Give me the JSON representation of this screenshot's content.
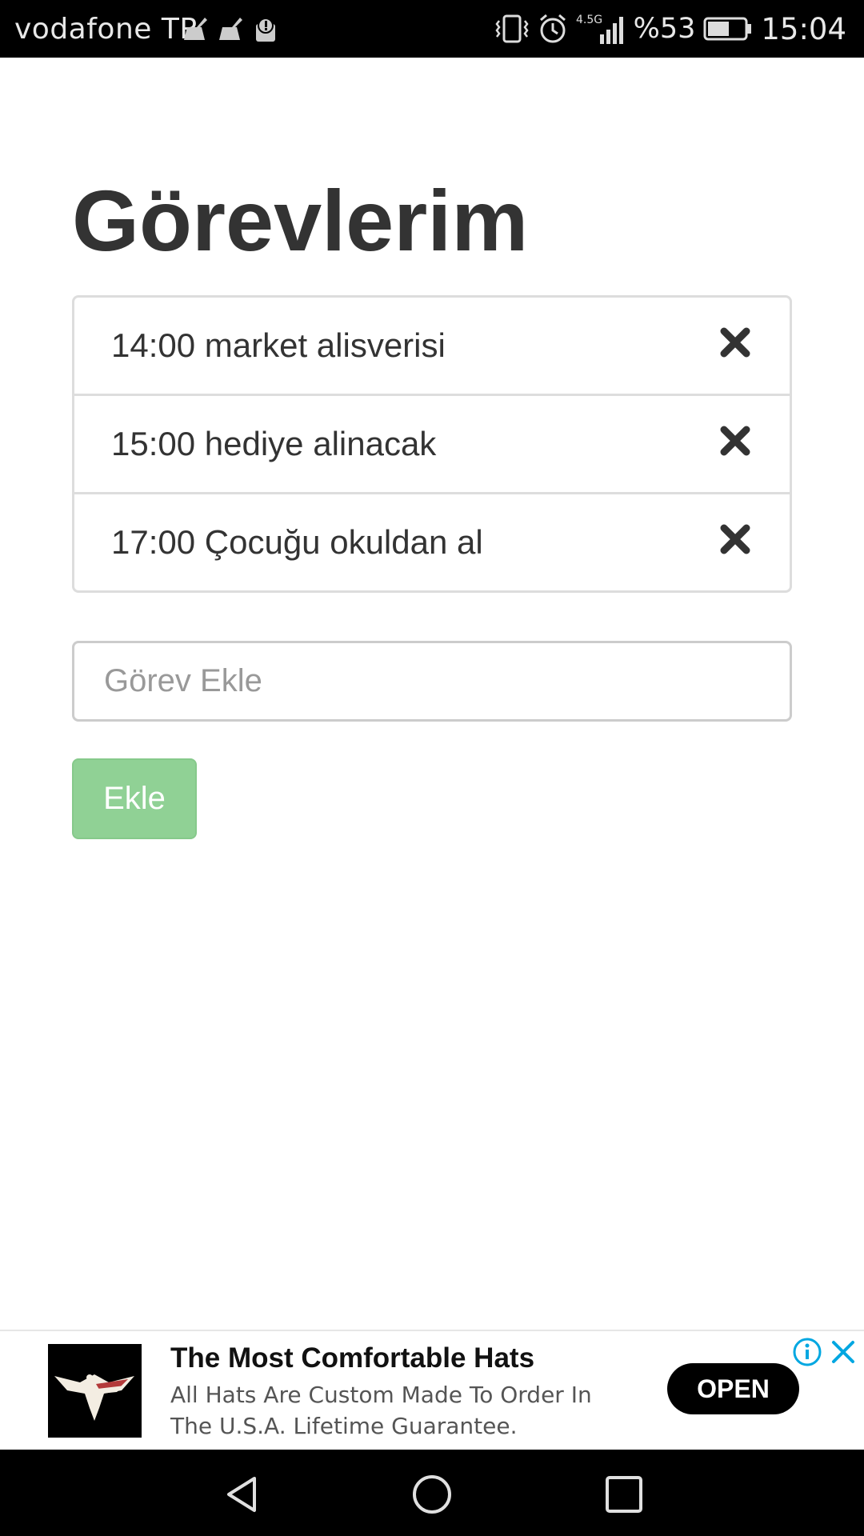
{
  "status_bar": {
    "carrier": "vodafone TR",
    "network": "4.5G",
    "battery_percent": "%53",
    "time": "15:04"
  },
  "page": {
    "title": "Görevlerim"
  },
  "tasks": [
    {
      "text": "14:00 market alisverisi"
    },
    {
      "text": "15:00 hediye alinacak"
    },
    {
      "text": "17:00 Çocuğu okuldan al"
    }
  ],
  "input": {
    "placeholder": "Görev Ekle",
    "value": ""
  },
  "add_button": {
    "label": "Ekle",
    "color": "#90d195"
  },
  "ad": {
    "title": "The Most Comfortable Hats",
    "description": "All Hats Are Custom Made To Order In The U.S.A. Lifetime Guarantee.",
    "open_label": "OPEN",
    "accent_color": "#00a7e1"
  },
  "icons": {
    "remove": "close-x-icon",
    "nav_back": "triangle-back-icon",
    "nav_home": "circle-home-icon",
    "nav_recents": "square-recents-icon"
  }
}
